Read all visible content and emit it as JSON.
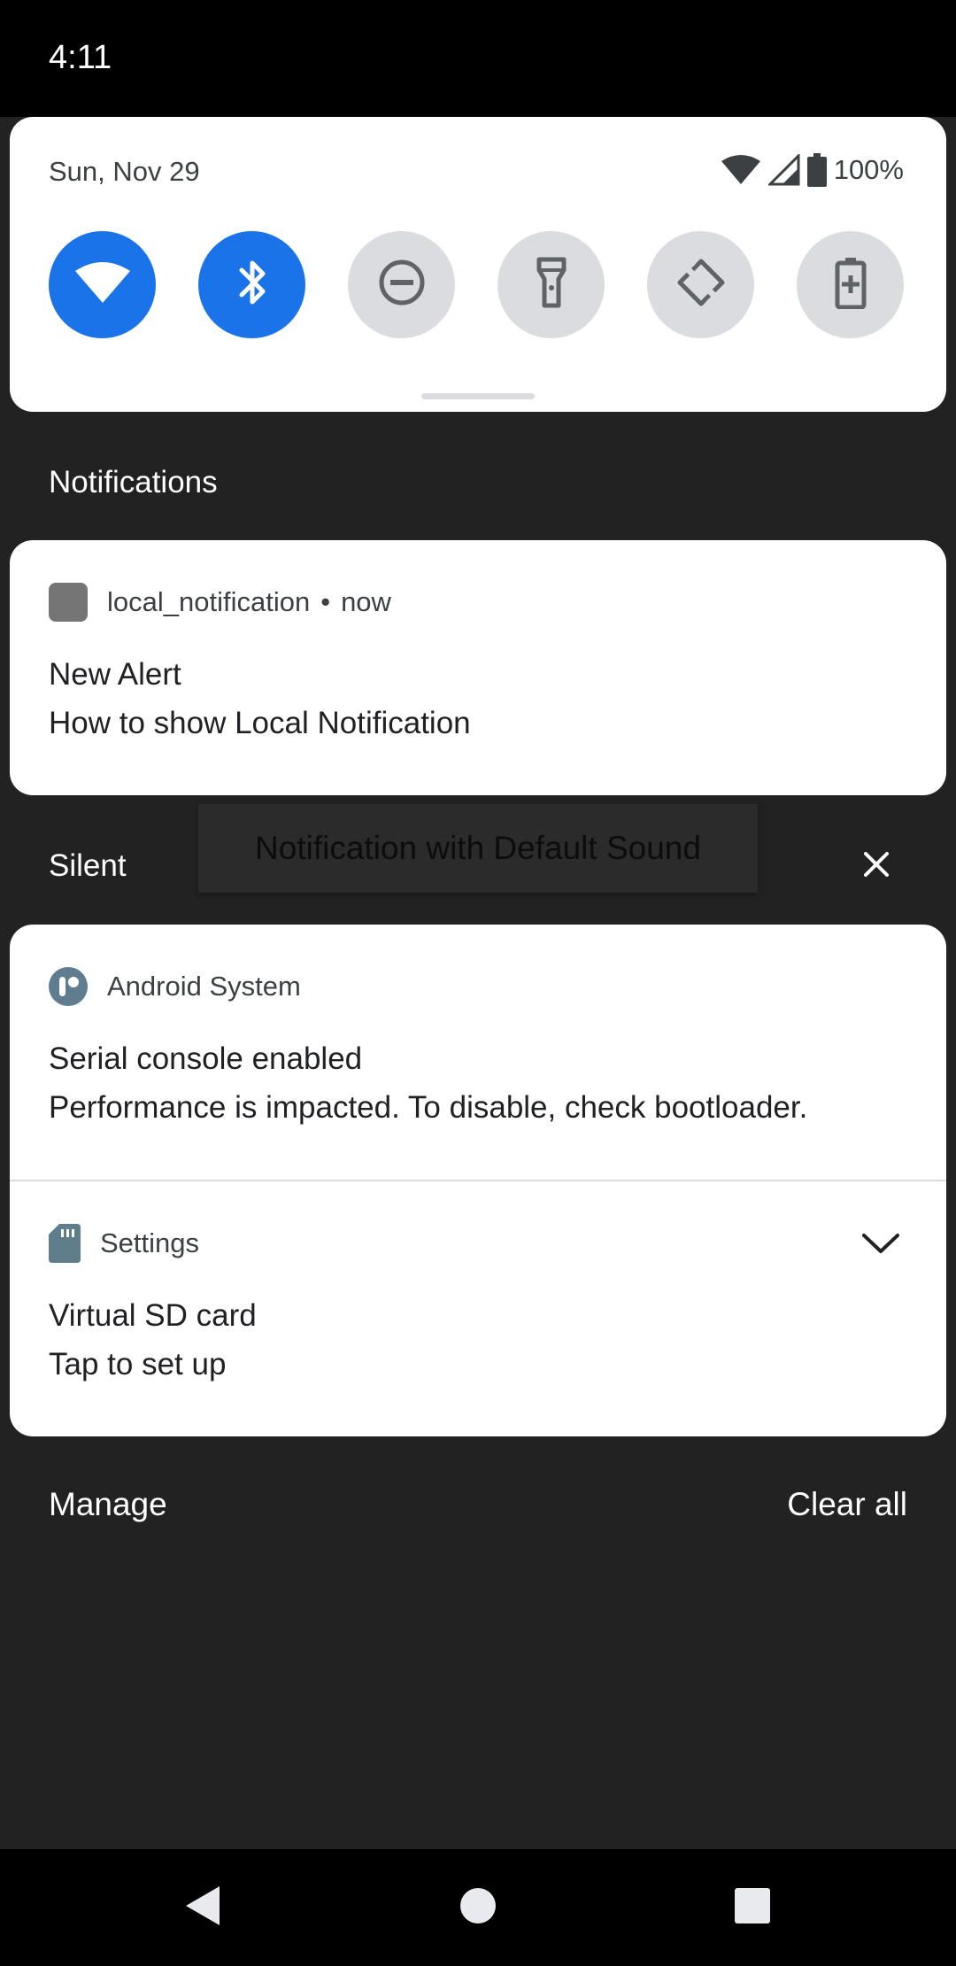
{
  "status_bar": {
    "time": "4:11"
  },
  "quick_settings": {
    "date": "Sun, Nov 29",
    "battery_percent": "100%",
    "tiles": [
      {
        "name": "wifi",
        "icon": "wifi-icon",
        "active": true
      },
      {
        "name": "bluetooth",
        "icon": "bluetooth-icon",
        "active": true
      },
      {
        "name": "do-not-disturb",
        "icon": "do-not-disturb-icon",
        "active": false
      },
      {
        "name": "flashlight",
        "icon": "flashlight-icon",
        "active": false
      },
      {
        "name": "auto-rotate",
        "icon": "auto-rotate-icon",
        "active": false
      },
      {
        "name": "battery-saver",
        "icon": "battery-saver-icon",
        "active": false
      }
    ]
  },
  "sections": {
    "notifications_header": "Notifications",
    "silent_header": "Silent"
  },
  "notifications": {
    "local": {
      "app": "local_notification",
      "separator": "•",
      "time": "now",
      "title": "New Alert",
      "text": "How to show Local Notification"
    },
    "android_system": {
      "app": "Android System",
      "title": "Serial console enabled",
      "text": "Performance is impacted. To disable, check bootloader."
    },
    "settings": {
      "app": "Settings",
      "title": "Virtual SD card",
      "text": "Tap to set up"
    }
  },
  "toast": {
    "text": "Notification with Default Sound"
  },
  "footer": {
    "manage": "Manage",
    "clear_all": "Clear all"
  },
  "colors": {
    "accent": "#1a73e8",
    "panel_bg": "#222222",
    "card_bg": "#ffffff",
    "tile_off": "#dadce0",
    "android_system_icon": "#5f7d8e",
    "settings_icon": "#607d8b"
  }
}
